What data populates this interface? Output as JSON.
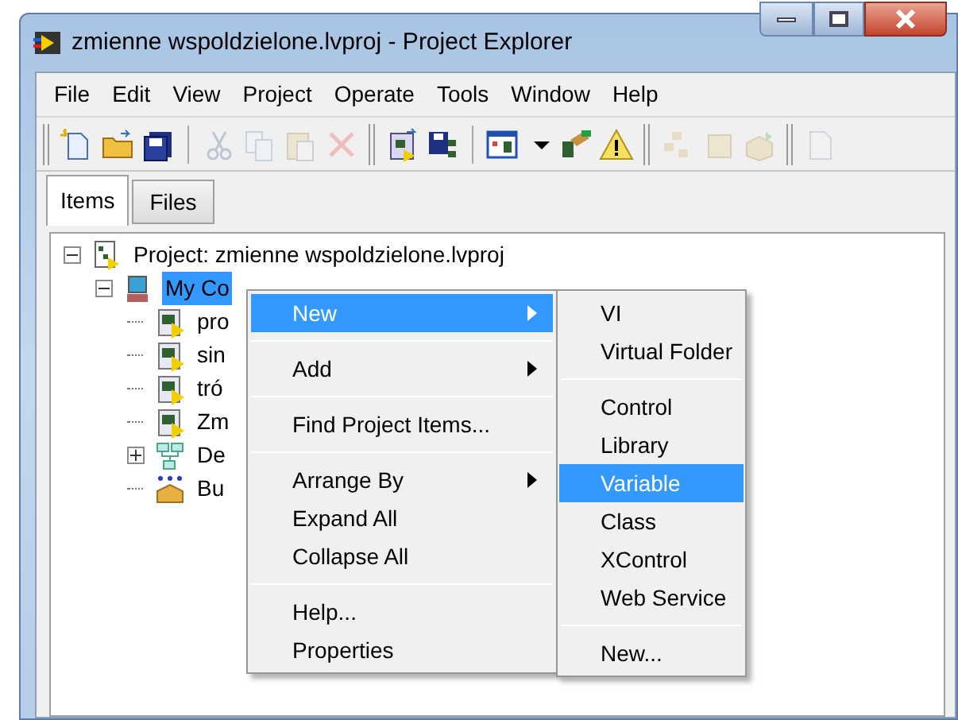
{
  "window": {
    "title": "zmienne wspoldzielone.lvproj - Project Explorer"
  },
  "menu_bar": [
    "File",
    "Edit",
    "View",
    "Project",
    "Operate",
    "Tools",
    "Window",
    "Help"
  ],
  "toolbar": [
    {
      "kind": "grip"
    },
    {
      "kind": "new",
      "disabled": false
    },
    {
      "kind": "open",
      "disabled": false
    },
    {
      "kind": "save-all",
      "disabled": false
    },
    {
      "kind": "sep"
    },
    {
      "kind": "cut",
      "disabled": true
    },
    {
      "kind": "copy",
      "disabled": true
    },
    {
      "kind": "paste",
      "disabled": true
    },
    {
      "kind": "delete",
      "disabled": true
    },
    {
      "kind": "grip"
    },
    {
      "kind": "add-vi",
      "disabled": false
    },
    {
      "kind": "save-tree",
      "disabled": false
    },
    {
      "kind": "sep"
    },
    {
      "kind": "view",
      "disabled": false
    },
    {
      "kind": "dropdown",
      "disabled": false
    },
    {
      "kind": "deploy",
      "disabled": false
    },
    {
      "kind": "warning",
      "disabled": false
    },
    {
      "kind": "grip"
    },
    {
      "kind": "boxes",
      "disabled": true
    },
    {
      "kind": "box",
      "disabled": true
    },
    {
      "kind": "box-arrow",
      "disabled": true
    },
    {
      "kind": "grip"
    },
    {
      "kind": "doc",
      "disabled": true
    }
  ],
  "tabs": [
    {
      "label": "Items",
      "selected": true
    },
    {
      "label": "Files",
      "selected": false
    }
  ],
  "tree": [
    {
      "label": "Project: zmienne wspoldzielone.lvproj",
      "kind": "project",
      "expanded": true,
      "selected": false,
      "children": [
        {
          "label": "My Co",
          "kind": "computer",
          "expanded": true,
          "selected": true,
          "children": [
            {
              "label": "pro",
              "kind": "vi",
              "selected": false
            },
            {
              "label": "sin",
              "kind": "vi",
              "selected": false
            },
            {
              "label": "tró",
              "kind": "vi",
              "selected": false
            },
            {
              "label": "Zm",
              "kind": "vi",
              "selected": false
            },
            {
              "label": "De",
              "kind": "dependencies",
              "expanded": false,
              "selected": false
            },
            {
              "label": "Bu",
              "kind": "build",
              "selected": false
            }
          ]
        }
      ]
    }
  ],
  "context_menu": [
    {
      "kind": "item",
      "label": "New",
      "submenu": true,
      "selected": true
    },
    {
      "kind": "separator"
    },
    {
      "kind": "item",
      "label": "Add",
      "submenu": true,
      "selected": false
    },
    {
      "kind": "separator"
    },
    {
      "kind": "item",
      "label": "Find Project Items...",
      "submenu": false,
      "selected": false
    },
    {
      "kind": "separator"
    },
    {
      "kind": "item",
      "label": "Arrange By",
      "submenu": true,
      "selected": false
    },
    {
      "kind": "item",
      "label": "Expand All",
      "submenu": false,
      "selected": false
    },
    {
      "kind": "item",
      "label": "Collapse All",
      "submenu": false,
      "selected": false
    },
    {
      "kind": "separator"
    },
    {
      "kind": "item",
      "label": "Help...",
      "submenu": false,
      "selected": false
    },
    {
      "kind": "item",
      "label": "Properties",
      "submenu": false,
      "selected": false
    }
  ],
  "submenu": [
    {
      "kind": "item",
      "label": "VI",
      "selected": false
    },
    {
      "kind": "item",
      "label": "Virtual Folder",
      "selected": false
    },
    {
      "kind": "separator"
    },
    {
      "kind": "item",
      "label": "Control",
      "selected": false
    },
    {
      "kind": "item",
      "label": "Library",
      "selected": false
    },
    {
      "kind": "item",
      "label": "Variable",
      "selected": true
    },
    {
      "kind": "item",
      "label": "Class",
      "selected": false
    },
    {
      "kind": "item",
      "label": "XControl",
      "selected": false
    },
    {
      "kind": "item",
      "label": "Web Service",
      "selected": false
    },
    {
      "kind": "separator"
    },
    {
      "kind": "item",
      "label": "New...",
      "selected": false
    }
  ]
}
